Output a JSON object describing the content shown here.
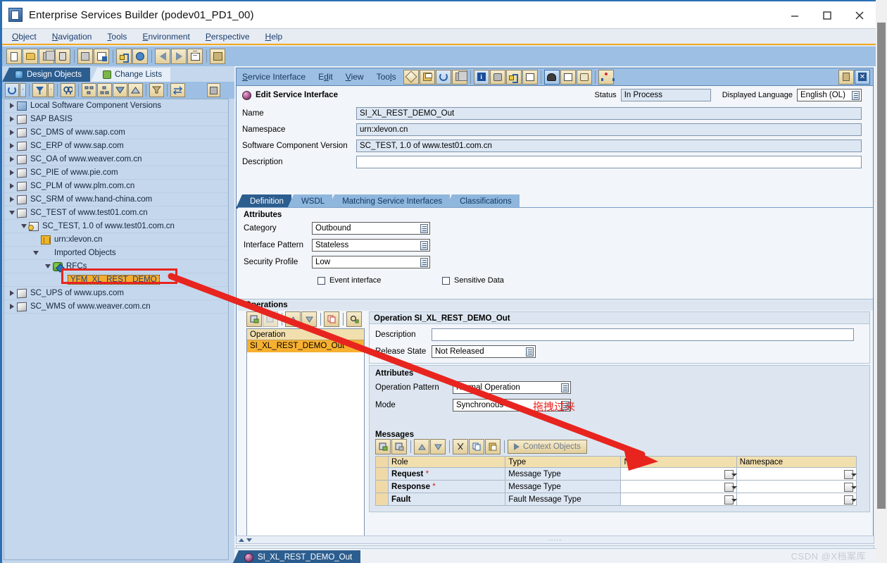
{
  "window": {
    "title": "Enterprise Services Builder (podev01_PD1_00)",
    "minimize": "–",
    "maximize": "□",
    "close": "✕"
  },
  "menubar": {
    "items": [
      {
        "label": "Object"
      },
      {
        "label": "Navigation"
      },
      {
        "label": "Tools"
      },
      {
        "label": "Environment"
      },
      {
        "label": "Perspective"
      },
      {
        "label": "Help"
      }
    ]
  },
  "main_toolbar": {
    "buttons": [
      {
        "name": "new-icon"
      },
      {
        "name": "open-folder-icon"
      },
      {
        "name": "copy-icon"
      },
      {
        "name": "delete-trash-icon"
      },
      {
        "name": "duplicate-icon"
      },
      {
        "name": "check-object-icon"
      },
      {
        "name": "navigate-icon"
      },
      {
        "name": "where-used-icon"
      },
      {
        "name": "back-arrow-icon"
      },
      {
        "name": "forward-arrow-icon"
      },
      {
        "name": "object-list-icon"
      },
      {
        "name": "properties-icon"
      }
    ]
  },
  "left_panel": {
    "tabs": [
      {
        "label": "Design Objects",
        "active": true,
        "icon": "design-objects-icon"
      },
      {
        "label": "Change Lists",
        "active": false,
        "icon": "change-lists-icon"
      }
    ],
    "toolbar": [
      {
        "name": "refresh-icon"
      },
      {
        "name": "filter-icon"
      },
      {
        "name": "find-icon"
      },
      {
        "name": "expand-subtree-icon"
      },
      {
        "name": "collapse-subtree-icon"
      },
      {
        "name": "expand-all-icon"
      },
      {
        "name": "collapse-all-icon"
      },
      {
        "name": "filter-objects-icon"
      },
      {
        "name": "sync-navigation-icon"
      },
      {
        "name": "stop-icon"
      }
    ],
    "tree": [
      {
        "label": "Local Software Component Versions",
        "indent": 0,
        "twisty": "right",
        "icon": "stack"
      },
      {
        "label": "SAP BASIS",
        "indent": 0,
        "twisty": "right",
        "icon": "cube"
      },
      {
        "label": "SC_DMS of www.sap.com",
        "indent": 0,
        "twisty": "right",
        "icon": "cube"
      },
      {
        "label": "SC_ERP of www.sap.com",
        "indent": 0,
        "twisty": "right",
        "icon": "cube"
      },
      {
        "label": "SC_OA of www.weaver.com.cn",
        "indent": 0,
        "twisty": "right",
        "icon": "cube"
      },
      {
        "label": "SC_PIE of www.pie.com",
        "indent": 0,
        "twisty": "right",
        "icon": "cube"
      },
      {
        "label": "SC_PLM of www.plm.com.cn",
        "indent": 0,
        "twisty": "right",
        "icon": "cube"
      },
      {
        "label": "SC_SRM of www.hand-china.com",
        "indent": 0,
        "twisty": "right",
        "icon": "cube"
      },
      {
        "label": "SC_TEST of www.test01.com.cn",
        "indent": 0,
        "twisty": "down",
        "icon": "cube"
      },
      {
        "label": "SC_TEST, 1.0 of www.test01.com.cn",
        "indent": 1,
        "twisty": "down",
        "icon": "cube2"
      },
      {
        "label": "urn:xlevon.cn",
        "indent": 2,
        "twisty": "none",
        "icon": "grid"
      },
      {
        "label": "Imported Objects",
        "indent": 2,
        "twisty": "down",
        "icon": "none"
      },
      {
        "label": "RFCs",
        "indent": 3,
        "twisty": "down",
        "icon": "rfc"
      },
      {
        "label": "YFM_XL_REST_DEMO",
        "indent": 4,
        "twisty": "none",
        "icon": "none",
        "selected": true
      },
      {
        "label": "SC_UPS of www.ups.com",
        "indent": 0,
        "twisty": "right",
        "icon": "cube"
      },
      {
        "label": "SC_WMS of www.weaver.com.cn",
        "indent": 0,
        "twisty": "right",
        "icon": "cube"
      }
    ]
  },
  "editor": {
    "menus": [
      {
        "label": "Service Interface"
      },
      {
        "label": "Edit"
      },
      {
        "label": "View"
      },
      {
        "label": "Tools"
      }
    ],
    "toolbar": [
      {
        "name": "edit-pencil-icon"
      },
      {
        "name": "save-icon"
      },
      {
        "name": "activate-refresh-icon"
      },
      {
        "name": "copy-object-icon"
      },
      {
        "name": "info-icon"
      },
      {
        "name": "documentation-icon"
      },
      {
        "name": "where-used-icon"
      },
      {
        "name": "compare-icon"
      },
      {
        "name": "hat-icon"
      },
      {
        "name": "table-view-icon"
      },
      {
        "name": "scroll-view-icon"
      },
      {
        "name": "network-icon"
      },
      {
        "name": "pin-icon"
      },
      {
        "name": "close-panel-icon"
      }
    ],
    "header": {
      "title": "Edit Service Interface",
      "status_label": "Status",
      "status_value": "In Process",
      "language_label": "Displayed Language",
      "language_value": "English (OL)",
      "fields": [
        {
          "label": "Name",
          "value": "SI_XL_REST_DEMO_Out",
          "readonly": true
        },
        {
          "label": "Namespace",
          "value": "urn:xlevon.cn",
          "readonly": true
        },
        {
          "label": "Software Component Version",
          "value": "SC_TEST, 1.0 of www.test01.com.cn",
          "readonly": true
        },
        {
          "label": "Description",
          "value": "",
          "readonly": false
        }
      ]
    },
    "subtabs": [
      {
        "label": "Definition",
        "active": true
      },
      {
        "label": "WSDL",
        "active": false
      },
      {
        "label": "Matching Service Interfaces",
        "active": false
      },
      {
        "label": "Classifications",
        "active": false
      }
    ],
    "attributes": {
      "title": "Attributes",
      "rows": [
        {
          "label": "Category",
          "value": "Outbound"
        },
        {
          "label": "Interface Pattern",
          "value": "Stateless"
        },
        {
          "label": "Security Profile",
          "value": "Low"
        }
      ],
      "checkboxes": [
        {
          "label": "Event interface",
          "checked": false
        },
        {
          "label": "Sensitive Data",
          "checked": false
        }
      ]
    },
    "operations": {
      "section_title": "Operations",
      "toolbar": [
        {
          "name": "insert-operation-icon"
        },
        {
          "name": "delete-operation-icon"
        },
        {
          "name": "move-up-icon"
        },
        {
          "name": "move-down-icon"
        },
        {
          "name": "copy-operation-icon"
        },
        {
          "name": "operation-settings-icon"
        }
      ],
      "column_header": "Operation",
      "rows": [
        {
          "label": "SI_XL_REST_DEMO_Out",
          "selected": true
        }
      ]
    },
    "operation_detail": {
      "title": "Operation SI_XL_REST_DEMO_Out",
      "description_label": "Description",
      "description_value": "",
      "release_state_label": "Release State",
      "release_state_value": "Not Released",
      "attributes_title": "Attributes",
      "rows": [
        {
          "label": "Operation Pattern",
          "value": "Normal Operation"
        },
        {
          "label": "Mode",
          "value": "Synchronous"
        }
      ],
      "messages": {
        "title": "Messages",
        "toolbar": [
          {
            "name": "insert-message-icon"
          },
          {
            "name": "delete-message-icon"
          },
          {
            "name": "move-up-icon"
          },
          {
            "name": "move-down-icon"
          },
          {
            "name": "cut-icon"
          },
          {
            "name": "copy-icon"
          },
          {
            "name": "paste-icon"
          }
        ],
        "context_objects_button": "Context Objects",
        "columns": [
          "Role",
          "Type",
          "Name",
          "Namespace"
        ],
        "rows": [
          {
            "role": "Request",
            "required": true,
            "type": "Message Type",
            "name": "",
            "namespace": ""
          },
          {
            "role": "Response",
            "required": true,
            "type": "Message Type",
            "name": "",
            "namespace": ""
          },
          {
            "role": "Fault",
            "required": false,
            "type": "Fault Message Type",
            "name": "",
            "namespace": ""
          }
        ]
      }
    }
  },
  "bottom": {
    "document_tab": "SI_XL_REST_DEMO_Out",
    "watermark": "CSDN @X档案库"
  },
  "annotation": {
    "note": "拖拽过来",
    "note_color": "#e8241f",
    "highlight_color": "#e8241f"
  },
  "colors": {
    "accent_blue": "#2c5d8f",
    "toolbar_blue": "#9dbfe4",
    "tree_bg": "#c5d7ec",
    "header_orange": "#f0a81e",
    "selected_row": "#f7b030",
    "table_header": "#f1dfae"
  }
}
